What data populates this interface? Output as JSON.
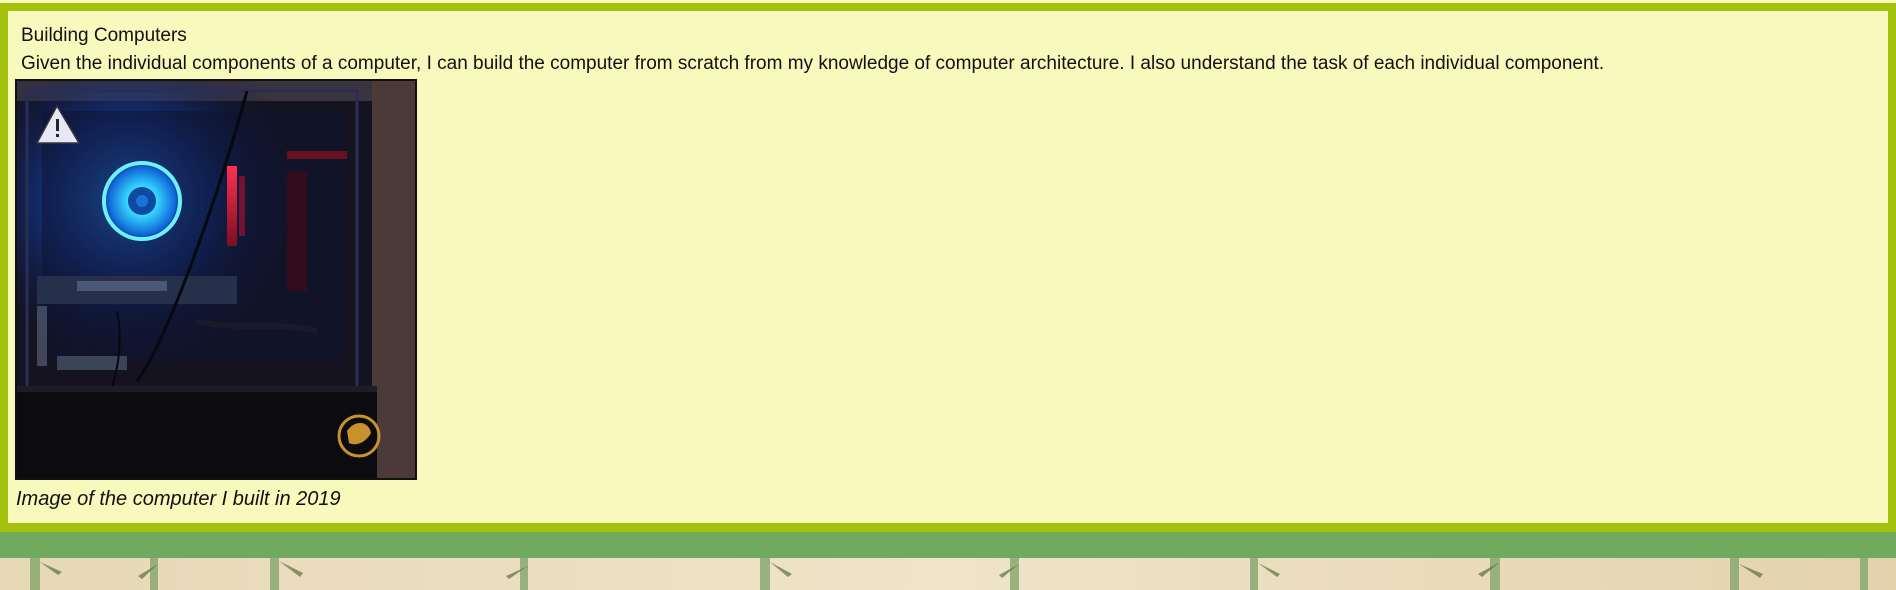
{
  "section": {
    "title": "Building Computers",
    "description": "Given the individual components of a computer, I can build the computer from scratch from my knowledge of computer architecture. I also understand the task of each individual component.",
    "image_alt": "Computer case with blue RGB cooler",
    "image_caption": "Image of the computer I built in 2019"
  },
  "colors": {
    "card_border": "#a2c00c",
    "card_fill": "#f7fabc",
    "footer_band": "#6faa5f",
    "accent_glow": "#1e90ff"
  }
}
